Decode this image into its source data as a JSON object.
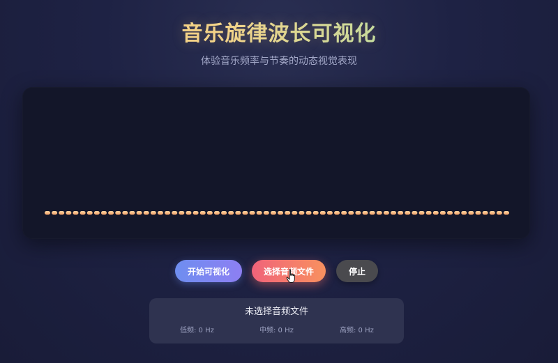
{
  "header": {
    "title": "音乐旋律波长可视化",
    "subtitle": "体验音乐频率与节奏的动态视觉表现"
  },
  "visualizer": {
    "bar_count": 66,
    "levels": "all bars at minimum",
    "bar_gradient": [
      "#f7a36b",
      "#f9d5a0"
    ]
  },
  "controls": {
    "start_label": "开始可视化",
    "file_label": "选择音频文件",
    "stop_label": "停止"
  },
  "info": {
    "file_status": "未选择音频文件",
    "low_freq": "低频: 0 Hz",
    "mid_freq": "中频: 0 Hz",
    "high_freq": "高频: 0 Hz"
  },
  "colors": {
    "start_button": [
      "#6e8ef0",
      "#8d7ff2"
    ],
    "file_button": [
      "#f0637a",
      "#f8915f"
    ],
    "stop_button": "#4a4a4e",
    "background": "#1e2244",
    "panel": "#131629"
  }
}
